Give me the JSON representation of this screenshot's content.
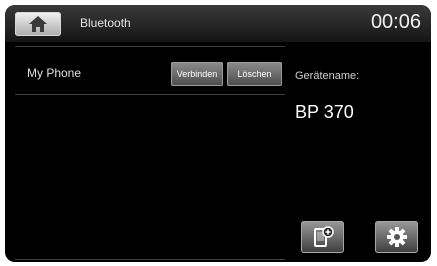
{
  "header": {
    "home_icon": "home-icon",
    "title": "Bluetooth",
    "clock": "00:06"
  },
  "devices": [
    {
      "name": "My Phone",
      "connect_label": "Verbinden",
      "delete_label": "Löschen"
    }
  ],
  "device_info": {
    "label": "Gerätename:",
    "value": "BP 370"
  },
  "buttons": {
    "phone_icon": "phone-add-icon",
    "settings_icon": "gear-icon"
  },
  "colors": {
    "background": "#000000",
    "text": "#ffffff",
    "button_gray": "#6e6e6e"
  }
}
